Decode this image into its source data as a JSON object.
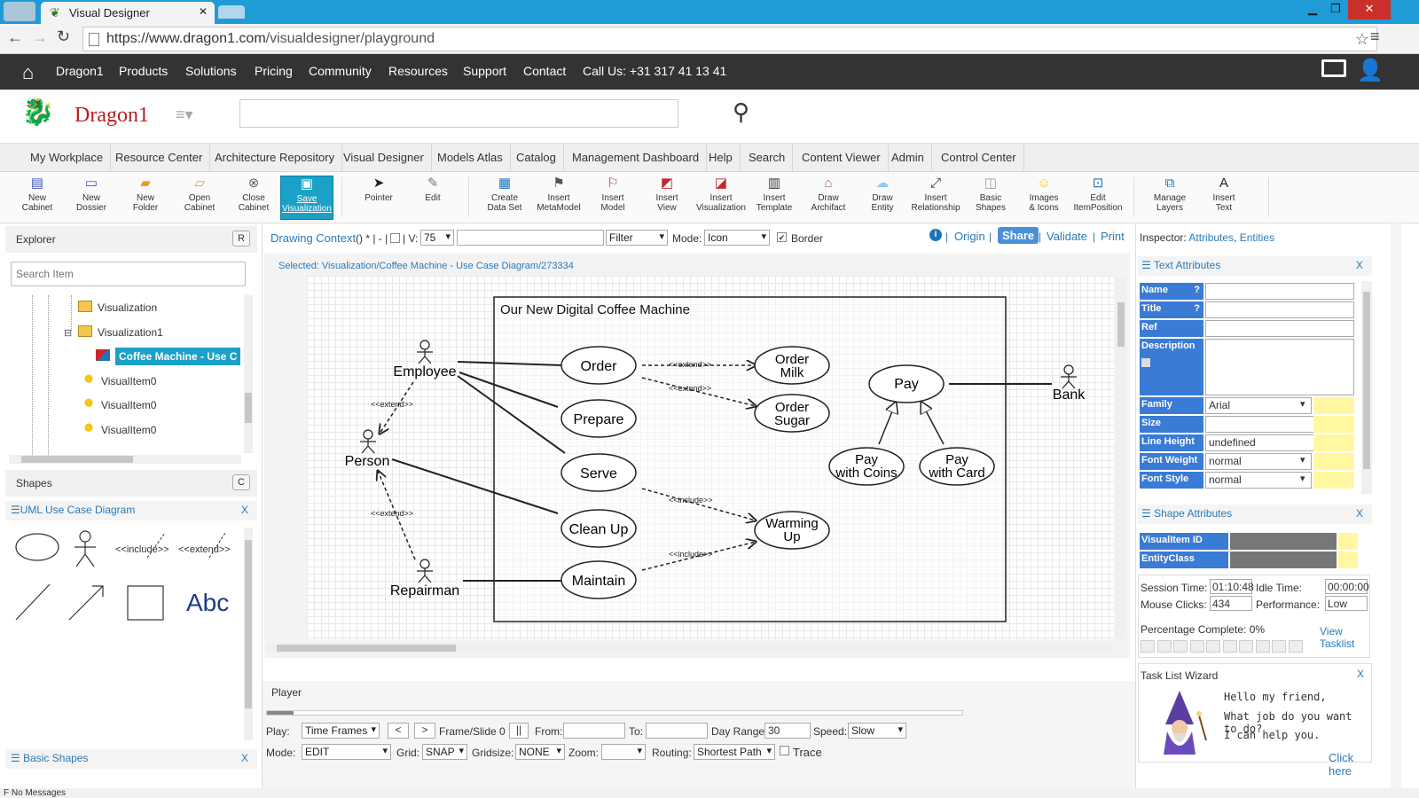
{
  "browser": {
    "tab_title": "Visual Designer",
    "url_prefix": "https://www.dragon1.com",
    "url_path": "/visualdesigner/playground",
    "win_min": "▁",
    "win_max": "❐",
    "win_close": "✕"
  },
  "topnav": {
    "items": [
      "Dragon1",
      "Products",
      "Solutions",
      "Pricing",
      "Community",
      "Resources",
      "Support",
      "Contact",
      "Call Us: +31 317 41 13 41"
    ]
  },
  "logo": {
    "text": "Dragon1"
  },
  "search": {
    "placeholder": ""
  },
  "menubar": {
    "items": [
      "My Workplace",
      "Resource Center",
      "Architecture Repository",
      "Visual Designer",
      "Models Atlas",
      "Catalog",
      "Management Dashboard",
      "Help",
      "Search",
      "Content Viewer",
      "Admin",
      "Control Center"
    ]
  },
  "toolbar": {
    "buttons": [
      {
        "l1": "New",
        "l2": "Cabinet",
        "icon": "cabinet-icon"
      },
      {
        "l1": "New",
        "l2": "Dossier",
        "icon": "dossier-icon"
      },
      {
        "l1": "New",
        "l2": "Folder",
        "icon": "folder-icon"
      },
      {
        "l1": "Open",
        "l2": "Cabinet",
        "icon": "open-folder-icon"
      },
      {
        "l1": "Close",
        "l2": "Cabinet",
        "icon": "close-icon"
      },
      {
        "l1": "Save",
        "l2": "Visualization",
        "icon": "save-icon"
      },
      {
        "l1": "Pointer",
        "l2": "",
        "icon": "pointer-icon"
      },
      {
        "l1": "Edit",
        "l2": "",
        "icon": "edit-icon"
      },
      {
        "l1": "Create",
        "l2": "Data Set",
        "icon": "dataset-icon"
      },
      {
        "l1": "Insert",
        "l2": "MetaModel",
        "icon": "metamodel-icon"
      },
      {
        "l1": "Insert",
        "l2": "Model",
        "icon": "model-icon"
      },
      {
        "l1": "Insert",
        "l2": "View",
        "icon": "view-icon"
      },
      {
        "l1": "Insert",
        "l2": "Visualization",
        "icon": "visualization-icon"
      },
      {
        "l1": "Insert",
        "l2": "Template",
        "icon": "template-icon"
      },
      {
        "l1": "Draw",
        "l2": "Archifact",
        "icon": "archifact-icon"
      },
      {
        "l1": "Draw",
        "l2": "Entity",
        "icon": "entity-icon"
      },
      {
        "l1": "Insert",
        "l2": "Relationship",
        "icon": "relationship-icon"
      },
      {
        "l1": "Basic",
        "l2": "Shapes",
        "icon": "shapes-icon"
      },
      {
        "l1": "Images",
        "l2": "& Icons",
        "icon": "smiley-icon"
      },
      {
        "l1": "Edit",
        "l2": "ItemPosition",
        "icon": "item-position-icon"
      },
      {
        "l1": "Manage",
        "l2": "Layers",
        "icon": "layers-icon"
      },
      {
        "l1": "Insert",
        "l2": "Text",
        "icon": "text-icon"
      }
    ]
  },
  "explorer": {
    "title": "Explorer",
    "btn": "R",
    "search_placeholder": "Search Item",
    "tree": [
      {
        "label": "Visualization",
        "icon": "folder-icon"
      },
      {
        "label": "Visualization1",
        "icon": "folder-icon",
        "toggle": "⊟"
      },
      {
        "label": "Coffee Machine - Use C",
        "icon": "visualization-icon",
        "selected": true
      },
      {
        "label": "VisualItem0",
        "icon": "visual-item-icon"
      },
      {
        "label": "VisualItem0",
        "icon": "visual-item-icon"
      },
      {
        "label": "VisualItem0",
        "icon": "visual-item-icon"
      }
    ]
  },
  "shapes": {
    "title": "Shapes",
    "btn": "C",
    "uml_title": "☰UML Use Case Diagram",
    "close": "X",
    "include": "<<include>>",
    "extend": "<<extend>>",
    "abc": "Abc",
    "basic_title": "☰ Basic Shapes"
  },
  "context": {
    "label": "Drawing Context",
    "suffix": "() * | - |",
    "v_label": "| V:",
    "v_value": "75",
    "filter": "Filter",
    "mode_label": "Mode:",
    "mode_value": "Icon",
    "border": "Border",
    "border_checked": true,
    "origin": "Origin",
    "share": "Share",
    "validate": "Validate",
    "print": "Print",
    "selected": "Selected: Visualization/Coffee Machine - Use Case Diagram/273334"
  },
  "diagram": {
    "system_title": "Our New Digital Coffee Machine",
    "actors": [
      "Employee",
      "Person",
      "Repairman",
      "Bank"
    ],
    "usecases": [
      "Order",
      "Prepare",
      "Serve",
      "Clean Up",
      "Maintain",
      "Order Milk",
      "Order Sugar",
      "Warming Up",
      "Pay",
      "Pay with Coins",
      "Pay with Card"
    ],
    "stereotypes": {
      "extend": "<<extend>>",
      "include": "<<include>>"
    }
  },
  "player": {
    "title": "Player",
    "play_label": "Play:",
    "play_value": "Time Frames",
    "prev": "<",
    "next": ">",
    "frame": "Frame/Slide 0",
    "pause": "||",
    "from": "From:",
    "to": "To:",
    "dayrange_label": "Day Range:",
    "dayrange_value": "30",
    "speed_label": "Speed:",
    "speed_value": "Slow",
    "mode_label": "Mode:",
    "mode_value": "EDIT",
    "grid_label": "Grid:",
    "grid_value": "SNAP",
    "gridsize_label": "Gridsize:",
    "gridsize_value": "NONE",
    "zoom_label": "Zoom:",
    "zoom_value": "",
    "routing_label": "Routing:",
    "routing_value": "Shortest Path",
    "trace": "Trace"
  },
  "inspector": {
    "title": "Inspector:",
    "attributes": "Attributes",
    "entities": "Entities",
    "text_attr_title": "☰ Text Attributes",
    "close": "X",
    "text_fields": [
      {
        "label": "Name",
        "value": "",
        "q": "?"
      },
      {
        "label": "Title",
        "value": "",
        "q": "?"
      },
      {
        "label": "Ref",
        "value": ""
      },
      {
        "label": "Description",
        "value": ""
      },
      {
        "label": "Family",
        "value": "Arial",
        "select": true
      },
      {
        "label": "Size",
        "value": ""
      },
      {
        "label": "Line Height",
        "value": "undefined"
      },
      {
        "label": "Font Weight",
        "value": "normal",
        "select": true
      },
      {
        "label": "Font Style",
        "value": "normal",
        "select": true
      }
    ],
    "shape_attr_title": "☰ Shape Attributes",
    "shape_fields": [
      {
        "label": "VisualItem ID",
        "value": ""
      },
      {
        "label": "EntityClass",
        "value": ""
      }
    ],
    "session_label": "Session Time:",
    "session_value": "01:10:48",
    "idle_label": "Idle Time:",
    "idle_value": "00:00:00",
    "clicks_label": "Mouse Clicks:",
    "clicks_value": "434",
    "perf_label": "Performance:",
    "perf_value": "Low",
    "pct_label": "Percentage Complete: 0%",
    "pct_value": 0,
    "view_tasklist": "View Tasklist",
    "wizard_title": "Task List Wizard",
    "wizard_lines": [
      "Hello my friend,",
      "What job do you want to do?",
      "I can help you."
    ],
    "click_here": "Click here"
  },
  "status": {
    "text": "F No Messages"
  },
  "colors": {
    "accent": "#1ba0c7",
    "nav_bg": "#333333",
    "link": "#2a7ab8",
    "label_blue": "#3a7bd5"
  }
}
